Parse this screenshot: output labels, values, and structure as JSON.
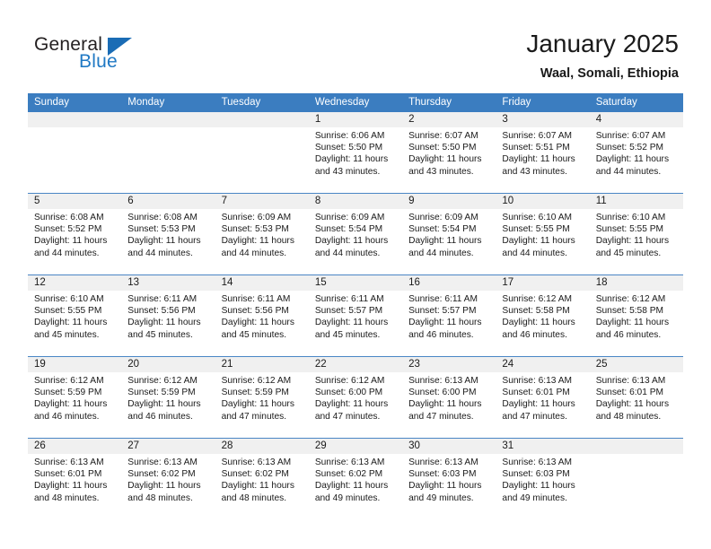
{
  "brand": {
    "name_top": "General",
    "name_bottom": "Blue",
    "accent_color": "#1a6cb5",
    "text_color": "#231f20"
  },
  "header": {
    "title": "January 2025",
    "subtitle": "Waal, Somali, Ethiopia"
  },
  "calendar": {
    "header_bg": "#3b7dc0",
    "day_strip_bg": "#f0f0f0",
    "weekdays": [
      "Sunday",
      "Monday",
      "Tuesday",
      "Wednesday",
      "Thursday",
      "Friday",
      "Saturday"
    ],
    "weeks": [
      [
        {
          "day": "",
          "empty": true
        },
        {
          "day": "",
          "empty": true
        },
        {
          "day": "",
          "empty": true
        },
        {
          "day": "1",
          "sunrise": "Sunrise: 6:06 AM",
          "sunset": "Sunset: 5:50 PM",
          "daylight": "Daylight: 11 hours and 43 minutes."
        },
        {
          "day": "2",
          "sunrise": "Sunrise: 6:07 AM",
          "sunset": "Sunset: 5:50 PM",
          "daylight": "Daylight: 11 hours and 43 minutes."
        },
        {
          "day": "3",
          "sunrise": "Sunrise: 6:07 AM",
          "sunset": "Sunset: 5:51 PM",
          "daylight": "Daylight: 11 hours and 43 minutes."
        },
        {
          "day": "4",
          "sunrise": "Sunrise: 6:07 AM",
          "sunset": "Sunset: 5:52 PM",
          "daylight": "Daylight: 11 hours and 44 minutes."
        }
      ],
      [
        {
          "day": "5",
          "sunrise": "Sunrise: 6:08 AM",
          "sunset": "Sunset: 5:52 PM",
          "daylight": "Daylight: 11 hours and 44 minutes."
        },
        {
          "day": "6",
          "sunrise": "Sunrise: 6:08 AM",
          "sunset": "Sunset: 5:53 PM",
          "daylight": "Daylight: 11 hours and 44 minutes."
        },
        {
          "day": "7",
          "sunrise": "Sunrise: 6:09 AM",
          "sunset": "Sunset: 5:53 PM",
          "daylight": "Daylight: 11 hours and 44 minutes."
        },
        {
          "day": "8",
          "sunrise": "Sunrise: 6:09 AM",
          "sunset": "Sunset: 5:54 PM",
          "daylight": "Daylight: 11 hours and 44 minutes."
        },
        {
          "day": "9",
          "sunrise": "Sunrise: 6:09 AM",
          "sunset": "Sunset: 5:54 PM",
          "daylight": "Daylight: 11 hours and 44 minutes."
        },
        {
          "day": "10",
          "sunrise": "Sunrise: 6:10 AM",
          "sunset": "Sunset: 5:55 PM",
          "daylight": "Daylight: 11 hours and 44 minutes."
        },
        {
          "day": "11",
          "sunrise": "Sunrise: 6:10 AM",
          "sunset": "Sunset: 5:55 PM",
          "daylight": "Daylight: 11 hours and 45 minutes."
        }
      ],
      [
        {
          "day": "12",
          "sunrise": "Sunrise: 6:10 AM",
          "sunset": "Sunset: 5:55 PM",
          "daylight": "Daylight: 11 hours and 45 minutes."
        },
        {
          "day": "13",
          "sunrise": "Sunrise: 6:11 AM",
          "sunset": "Sunset: 5:56 PM",
          "daylight": "Daylight: 11 hours and 45 minutes."
        },
        {
          "day": "14",
          "sunrise": "Sunrise: 6:11 AM",
          "sunset": "Sunset: 5:56 PM",
          "daylight": "Daylight: 11 hours and 45 minutes."
        },
        {
          "day": "15",
          "sunrise": "Sunrise: 6:11 AM",
          "sunset": "Sunset: 5:57 PM",
          "daylight": "Daylight: 11 hours and 45 minutes."
        },
        {
          "day": "16",
          "sunrise": "Sunrise: 6:11 AM",
          "sunset": "Sunset: 5:57 PM",
          "daylight": "Daylight: 11 hours and 46 minutes."
        },
        {
          "day": "17",
          "sunrise": "Sunrise: 6:12 AM",
          "sunset": "Sunset: 5:58 PM",
          "daylight": "Daylight: 11 hours and 46 minutes."
        },
        {
          "day": "18",
          "sunrise": "Sunrise: 6:12 AM",
          "sunset": "Sunset: 5:58 PM",
          "daylight": "Daylight: 11 hours and 46 minutes."
        }
      ],
      [
        {
          "day": "19",
          "sunrise": "Sunrise: 6:12 AM",
          "sunset": "Sunset: 5:59 PM",
          "daylight": "Daylight: 11 hours and 46 minutes."
        },
        {
          "day": "20",
          "sunrise": "Sunrise: 6:12 AM",
          "sunset": "Sunset: 5:59 PM",
          "daylight": "Daylight: 11 hours and 46 minutes."
        },
        {
          "day": "21",
          "sunrise": "Sunrise: 6:12 AM",
          "sunset": "Sunset: 5:59 PM",
          "daylight": "Daylight: 11 hours and 47 minutes."
        },
        {
          "day": "22",
          "sunrise": "Sunrise: 6:12 AM",
          "sunset": "Sunset: 6:00 PM",
          "daylight": "Daylight: 11 hours and 47 minutes."
        },
        {
          "day": "23",
          "sunrise": "Sunrise: 6:13 AM",
          "sunset": "Sunset: 6:00 PM",
          "daylight": "Daylight: 11 hours and 47 minutes."
        },
        {
          "day": "24",
          "sunrise": "Sunrise: 6:13 AM",
          "sunset": "Sunset: 6:01 PM",
          "daylight": "Daylight: 11 hours and 47 minutes."
        },
        {
          "day": "25",
          "sunrise": "Sunrise: 6:13 AM",
          "sunset": "Sunset: 6:01 PM",
          "daylight": "Daylight: 11 hours and 48 minutes."
        }
      ],
      [
        {
          "day": "26",
          "sunrise": "Sunrise: 6:13 AM",
          "sunset": "Sunset: 6:01 PM",
          "daylight": "Daylight: 11 hours and 48 minutes."
        },
        {
          "day": "27",
          "sunrise": "Sunrise: 6:13 AM",
          "sunset": "Sunset: 6:02 PM",
          "daylight": "Daylight: 11 hours and 48 minutes."
        },
        {
          "day": "28",
          "sunrise": "Sunrise: 6:13 AM",
          "sunset": "Sunset: 6:02 PM",
          "daylight": "Daylight: 11 hours and 48 minutes."
        },
        {
          "day": "29",
          "sunrise": "Sunrise: 6:13 AM",
          "sunset": "Sunset: 6:02 PM",
          "daylight": "Daylight: 11 hours and 49 minutes."
        },
        {
          "day": "30",
          "sunrise": "Sunrise: 6:13 AM",
          "sunset": "Sunset: 6:03 PM",
          "daylight": "Daylight: 11 hours and 49 minutes."
        },
        {
          "day": "31",
          "sunrise": "Sunrise: 6:13 AM",
          "sunset": "Sunset: 6:03 PM",
          "daylight": "Daylight: 11 hours and 49 minutes."
        },
        {
          "day": "",
          "empty": true
        }
      ]
    ]
  }
}
